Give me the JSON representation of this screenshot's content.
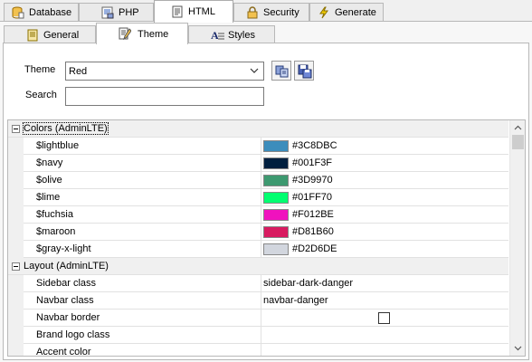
{
  "top_tabs": [
    {
      "label": "Database",
      "icon": "database-icon"
    },
    {
      "label": "PHP",
      "icon": "php-icon"
    },
    {
      "label": "HTML",
      "icon": "html-icon"
    },
    {
      "label": "Security",
      "icon": "lock-icon"
    },
    {
      "label": "Generate",
      "icon": "lightning-icon"
    }
  ],
  "sub_tabs": [
    {
      "label": "General",
      "icon": "page-icon"
    },
    {
      "label": "Theme",
      "icon": "theme-icon"
    },
    {
      "label": "Styles",
      "icon": "styles-icon"
    }
  ],
  "form": {
    "theme_label": "Theme",
    "theme_value": "Red",
    "search_label": "Search",
    "search_value": ""
  },
  "grid": {
    "categories": [
      {
        "label": "Colors (AdminLTE)",
        "rows": [
          {
            "name": "$lightblue",
            "hex": "#3C8DBC"
          },
          {
            "name": "$navy",
            "hex": "#001F3F"
          },
          {
            "name": "$olive",
            "hex": "#3D9970"
          },
          {
            "name": "$lime",
            "hex": "#01FF70"
          },
          {
            "name": "$fuchsia",
            "hex": "#F012BE"
          },
          {
            "name": "$maroon",
            "hex": "#D81B60"
          },
          {
            "name": "$gray-x-light",
            "hex": "#D2D6DE"
          }
        ]
      },
      {
        "label": "Layout (AdminLTE)",
        "rows": [
          {
            "name": "Sidebar class",
            "value": "sidebar-dark-danger"
          },
          {
            "name": "Navbar class",
            "value": "navbar-danger"
          },
          {
            "name": "Navbar border",
            "value": "",
            "checked": false
          },
          {
            "name": "Brand logo class",
            "value": ""
          },
          {
            "name": "Accent color",
            "value": ""
          }
        ]
      }
    ]
  },
  "colors": {
    "accent_blue": "#2f5fbf",
    "panel_border": "#b8b8b8"
  }
}
